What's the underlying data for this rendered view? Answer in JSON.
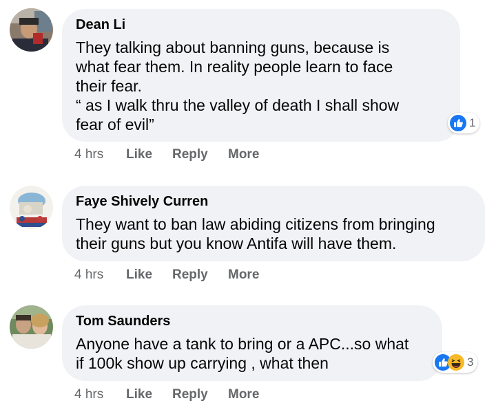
{
  "comments": [
    {
      "author": "Dean Li",
      "text": "They talking about banning guns, because is\nwhat fear them. In reality people learn to face\ntheir fear.\n“ as I walk thru the valley of death I shall show\nfear of evil”",
      "time": "4 hrs",
      "like_label": "Like",
      "reply_label": "Reply",
      "more_label": "More",
      "reaction_count": "1",
      "reaction_icons": [
        "like-icon"
      ]
    },
    {
      "author": "Faye Shively Curren",
      "text": "They want to ban law abiding citizens from bringing\ntheir guns but you know Antifa will have them.",
      "time": "4 hrs",
      "like_label": "Like",
      "reply_label": "Reply",
      "more_label": "More"
    },
    {
      "author": "Tom Saunders",
      "text": "Anyone have a tank to bring or a APC...so what\nif 100k show up carrying , what then",
      "time": "4 hrs",
      "like_label": "Like",
      "reply_label": "Reply",
      "more_label": "More",
      "reaction_count": "3",
      "reaction_icons": [
        "like-icon",
        "haha-icon"
      ]
    }
  ],
  "colors": {
    "bubble": "#f0f2f5",
    "like_blue": "#1877f2",
    "haha_yellow": "#f7b928",
    "meta_gray": "#65676b"
  }
}
